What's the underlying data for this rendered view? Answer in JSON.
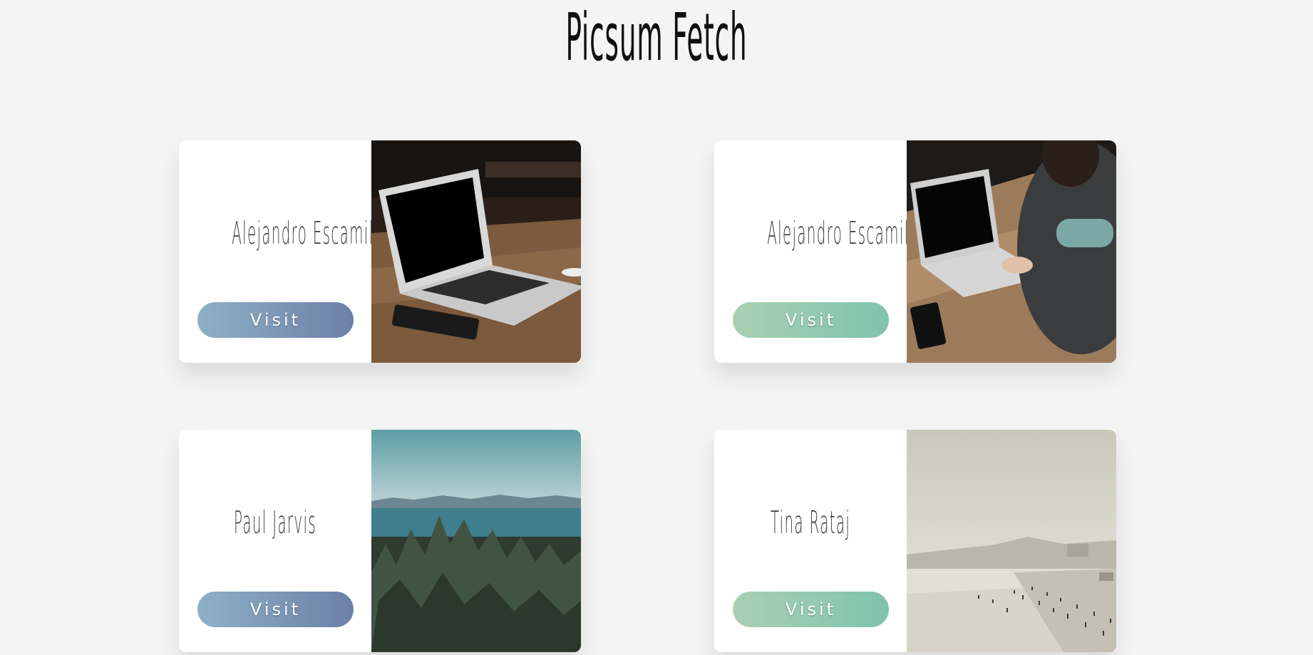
{
  "page": {
    "title": "Picsum Fetch"
  },
  "cards": [
    {
      "author": "Alejandro Escamilla",
      "button": "Visit",
      "photo": "laptop-on-table-photo"
    },
    {
      "author": "Alejandro Escamilla",
      "button": "Visit",
      "photo": "person-typing-laptop-photo"
    },
    {
      "author": "Paul Jarvis",
      "button": "Visit",
      "photo": "forest-and-sea-photo"
    },
    {
      "author": "Tina Rataj",
      "button": "Visit",
      "photo": "foggy-beach-photo"
    }
  ],
  "colors": {
    "background": "#f4f4f4",
    "blue_button_start": "#8eb1c6",
    "blue_button_end": "#6c7fa8",
    "green_button_start": "#aad0b4",
    "green_button_end": "#7ec3ad"
  }
}
